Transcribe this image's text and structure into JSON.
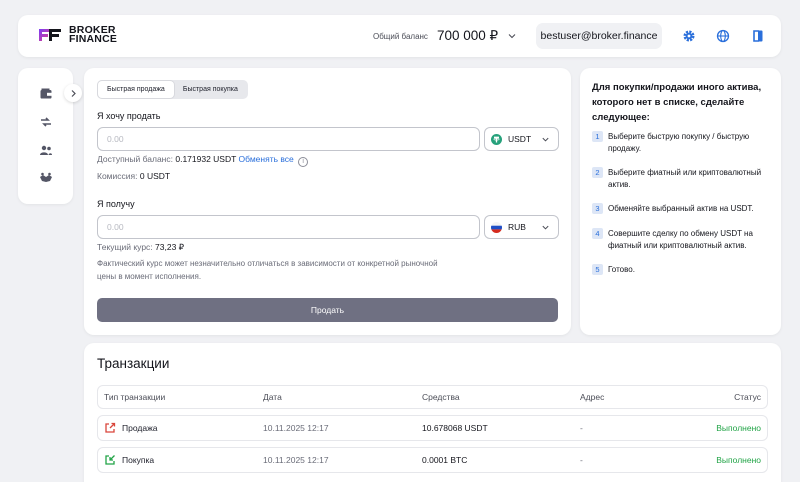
{
  "header": {
    "logo_line1": "BROKER",
    "logo_line2": "FINANCE",
    "balance_label": "Общий баланс",
    "balance_value": "700 000 ₽",
    "email": "bestuser@broker.finance",
    "icons": [
      "settings-gear-icon",
      "globe-icon",
      "logout-icon"
    ],
    "accent": "#2a6fdb"
  },
  "sidebar": {
    "items": [
      "wallet-icon",
      "exchange-icon",
      "users-icon",
      "handshake-icon"
    ],
    "expand_icon": "chevron-right-icon"
  },
  "exchange": {
    "tabs": [
      {
        "label": "Быстрая продажа",
        "active": true
      },
      {
        "label": "Быстрая покупка",
        "active": false
      }
    ],
    "sell_label": "Я хочу продать",
    "sell_placeholder": "0.00",
    "sell_currency": "USDT",
    "available_label": "Доступный баланс:",
    "available_value": "0.171932 USDT",
    "exchange_all": "Обменять все",
    "fee_label": "Комиссия:",
    "fee_value": "0 USDT",
    "receive_label": "Я получу",
    "receive_placeholder": "0.00",
    "receive_currency": "RUB",
    "rate_label": "Текущий курс:",
    "rate_value": "73,23 ₽",
    "note": "Фактический курс может незначительно отличаться в зависимости от конкретной рыночной цены в момент исполнения.",
    "submit_label": "Продать",
    "submit_color": "#6f7082"
  },
  "instructions": {
    "title": "Для покупки/продажи иного актива, которого нет в списке, сделайте следующее:",
    "steps": [
      {
        "num": "1",
        "text": "Выберите быструю покупку / быструю продажу."
      },
      {
        "num": "2",
        "text": "Выберите фиатный или криптовалютный актив."
      },
      {
        "num": "3",
        "text": "Обменяйте выбранный актив на USDT."
      },
      {
        "num": "4",
        "text": "Совершите сделку по обмену USDT на фиатный или криптовалютный актив."
      },
      {
        "num": "5",
        "text": "Готово."
      }
    ]
  },
  "transactions": {
    "title": "Транзакции",
    "columns": [
      "Тип транзакции",
      "Дата",
      "Средства",
      "Адрес",
      "Статус"
    ],
    "rows": [
      {
        "type": "Продажа",
        "icon": "sell-arrow-icon",
        "date": "10.11.2025 12:17",
        "amount": "10.678068 USDT",
        "address": "-",
        "status": "Выполнено"
      },
      {
        "type": "Покупка",
        "icon": "buy-arrow-icon",
        "date": "10.11.2025 12:17",
        "amount": "0.0001 BTC",
        "address": "-",
        "status": "Выполнено"
      }
    ],
    "status_color": "#22a447"
  }
}
